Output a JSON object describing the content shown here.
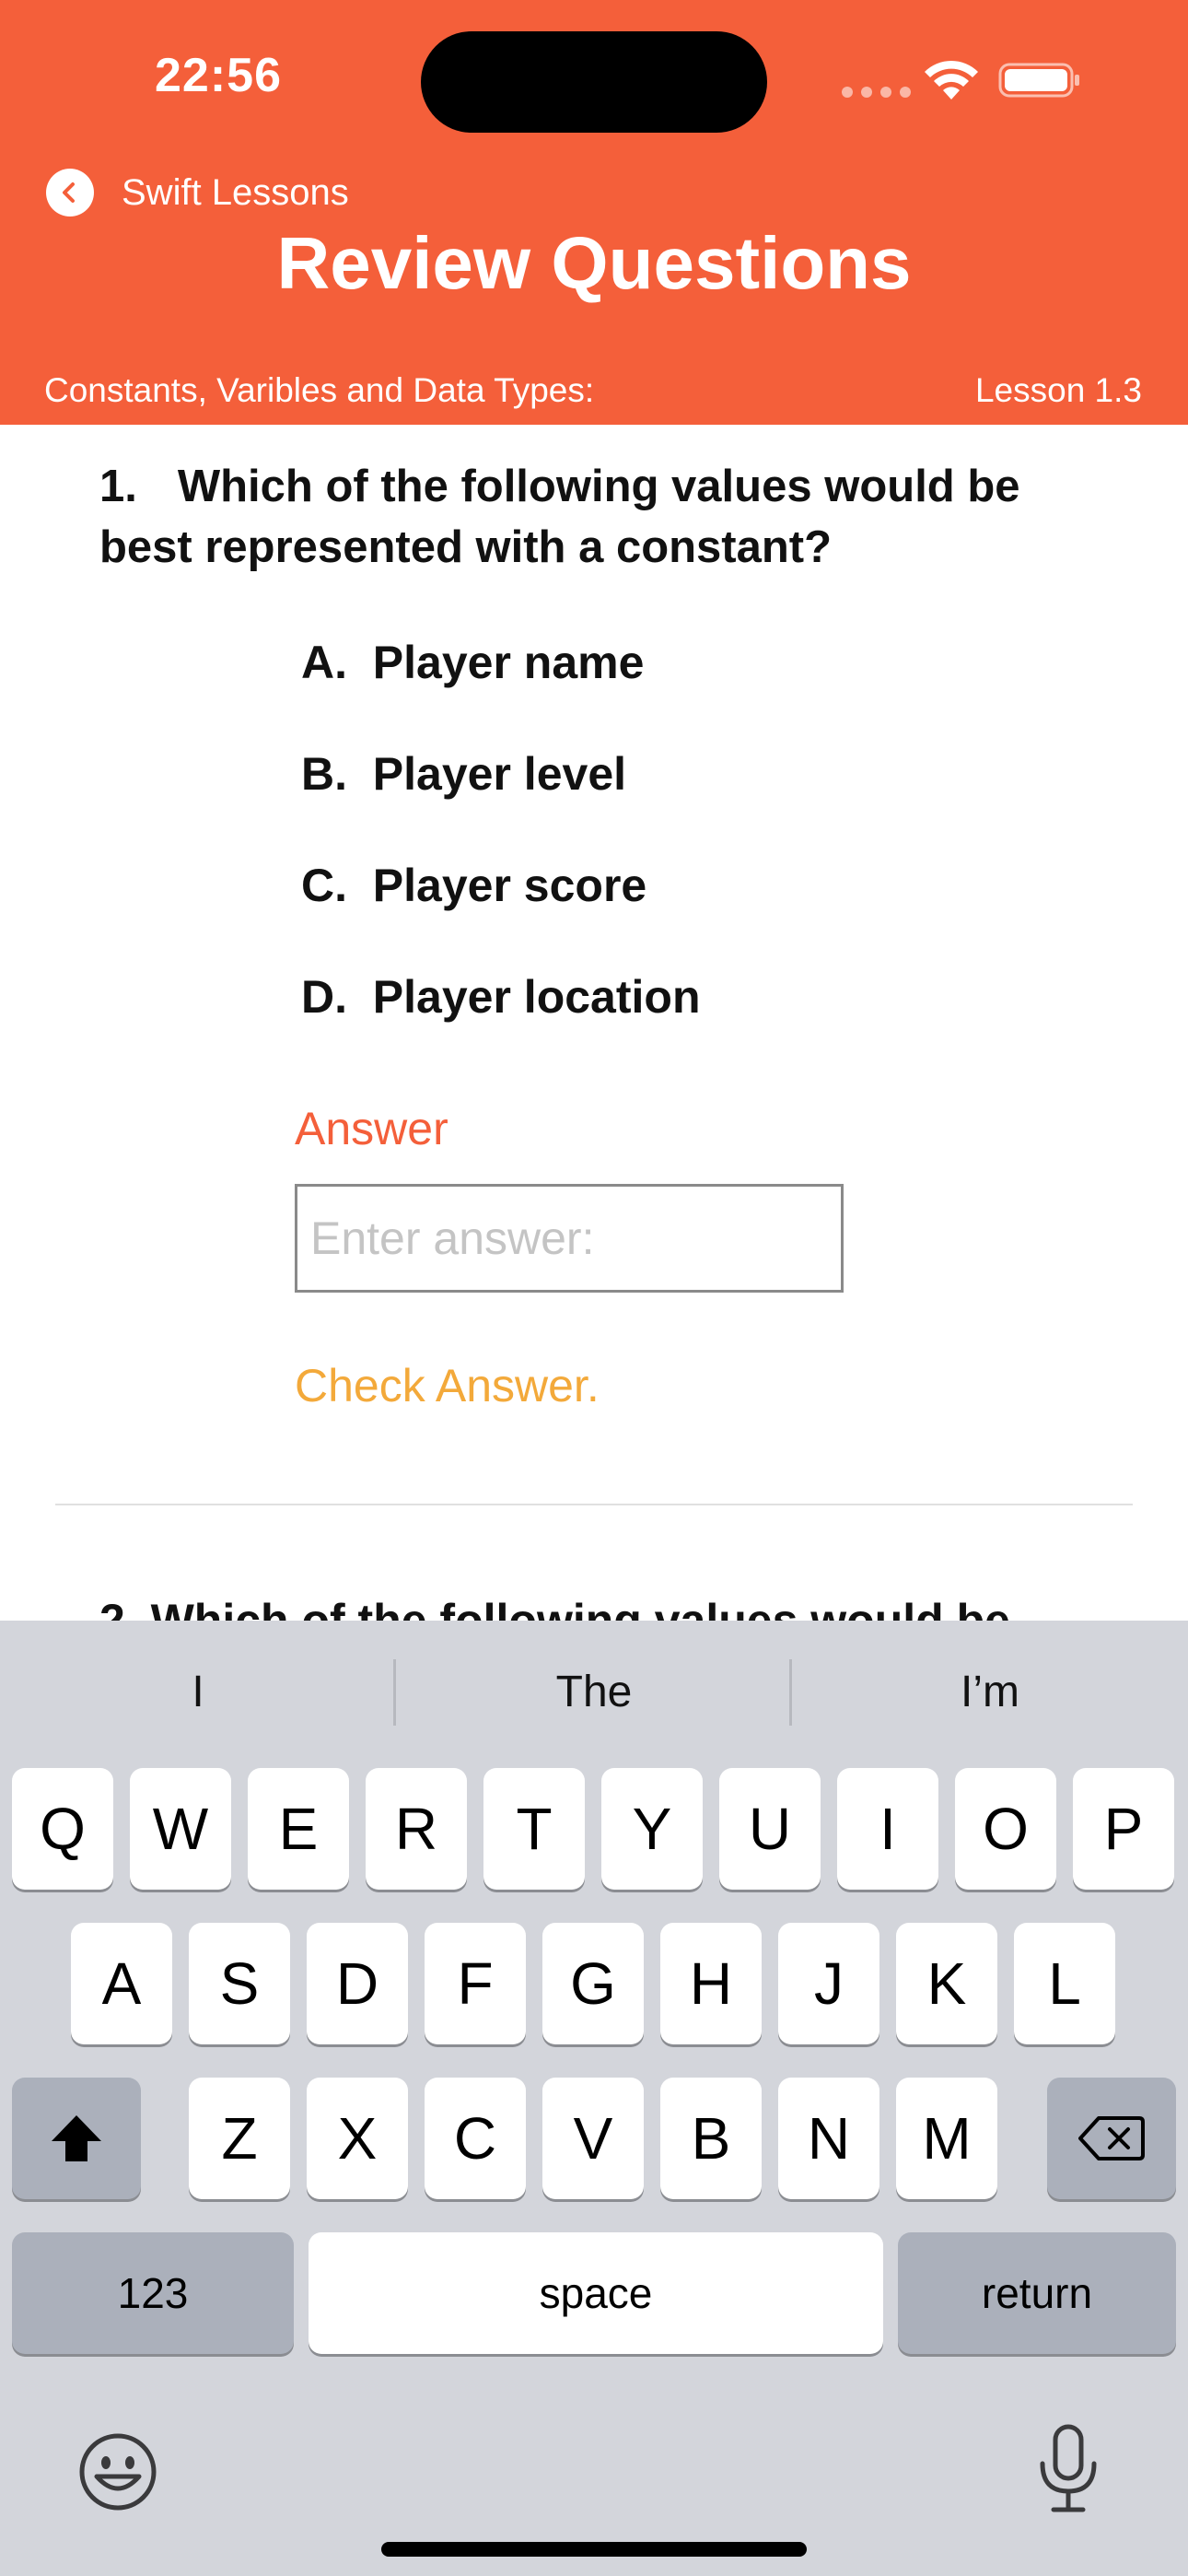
{
  "status_bar": {
    "time": "22:56"
  },
  "nav": {
    "back_label": "Swift Lessons",
    "title": "Review Questions",
    "subtitle_left": "Constants, Varibles and Data Types:",
    "subtitle_right": "Lesson 1.3"
  },
  "question1": {
    "number": "1.",
    "text": "Which of the following values would be best represented with a constant?",
    "options": [
      {
        "letter": "A.",
        "text": "Player name"
      },
      {
        "letter": "B.",
        "text": "Player level"
      },
      {
        "letter": "C.",
        "text": "Player score"
      },
      {
        "letter": "D.",
        "text": "Player location"
      }
    ],
    "answer_label": "Answer",
    "answer_value": "",
    "answer_placeholder": "Enter answer:",
    "check_label": "Check Answer."
  },
  "question2_partial": "2.    Which of the following values would be",
  "keyboard": {
    "suggestions": [
      "I",
      "The",
      "I’m"
    ],
    "row1": [
      "Q",
      "W",
      "E",
      "R",
      "T",
      "Y",
      "U",
      "I",
      "O",
      "P"
    ],
    "row2": [
      "A",
      "S",
      "D",
      "F",
      "G",
      "H",
      "J",
      "K",
      "L"
    ],
    "row3": [
      "Z",
      "X",
      "C",
      "V",
      "B",
      "N",
      "M"
    ],
    "numbers_label": "123",
    "space_label": "space",
    "return_label": "return"
  },
  "colors": {
    "accent": "#f45f3a",
    "check": "#f3a93a",
    "keyboard_bg": "#d3d5db"
  }
}
